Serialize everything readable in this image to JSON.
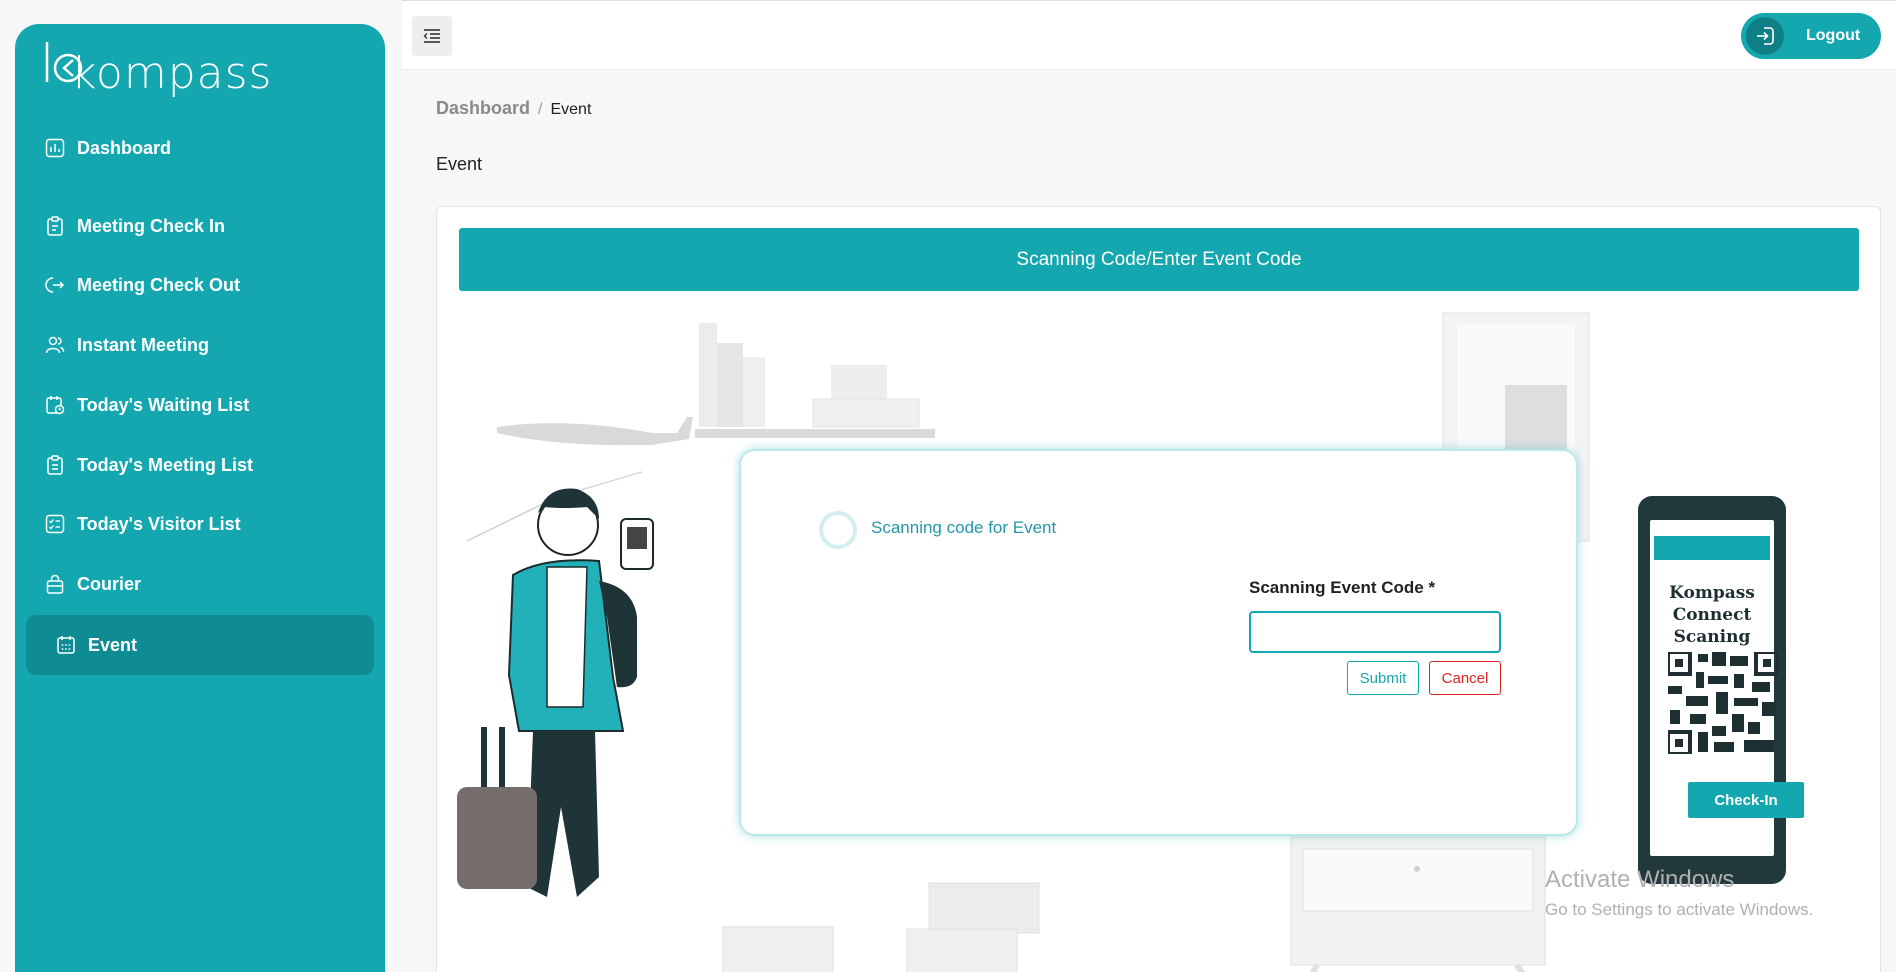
{
  "sidebar": {
    "logo_text": "kompass",
    "items": [
      {
        "label": "Dashboard",
        "icon": "dashboard-chart-icon"
      },
      {
        "label": "Meeting Check In",
        "icon": "clipboard-icon"
      },
      {
        "label": "Meeting Check Out",
        "icon": "logout-arrow-icon"
      },
      {
        "label": "Instant Meeting",
        "icon": "users-icon"
      },
      {
        "label": "Today's Waiting List",
        "icon": "calendar-clock-icon"
      },
      {
        "label": "Today's Meeting List",
        "icon": "clipboard-list-icon"
      },
      {
        "label": "Today's Visitor List",
        "icon": "checklist-icon"
      },
      {
        "label": "Courier",
        "icon": "bag-icon"
      },
      {
        "label": "Event",
        "icon": "calendar-icon",
        "active": true
      }
    ]
  },
  "topbar": {
    "menu_icon": "menu-collapse-icon",
    "logout_label": "Logout"
  },
  "breadcrumb": {
    "home": "Dashboard",
    "separator": "/",
    "current": "Event"
  },
  "page": {
    "title": "Event",
    "banner": "Scanning Code/Enter Event Code"
  },
  "modal": {
    "title": "Scanning code for Event",
    "field_label": "Scanning Event Code *",
    "field_value": "",
    "submit_label": "Submit",
    "cancel_label": "Cancel"
  },
  "illustration": {
    "phone_title_line1": "Kompass Connect",
    "phone_title_line2": "Scaning",
    "phone_button": "Check-In"
  },
  "watermark": {
    "title": "Activate Windows",
    "subtitle": "Go to Settings to activate Windows."
  },
  "colors": {
    "primary": "#14a7b0",
    "primary_dark": "#0f8c93",
    "danger": "#e02424"
  }
}
